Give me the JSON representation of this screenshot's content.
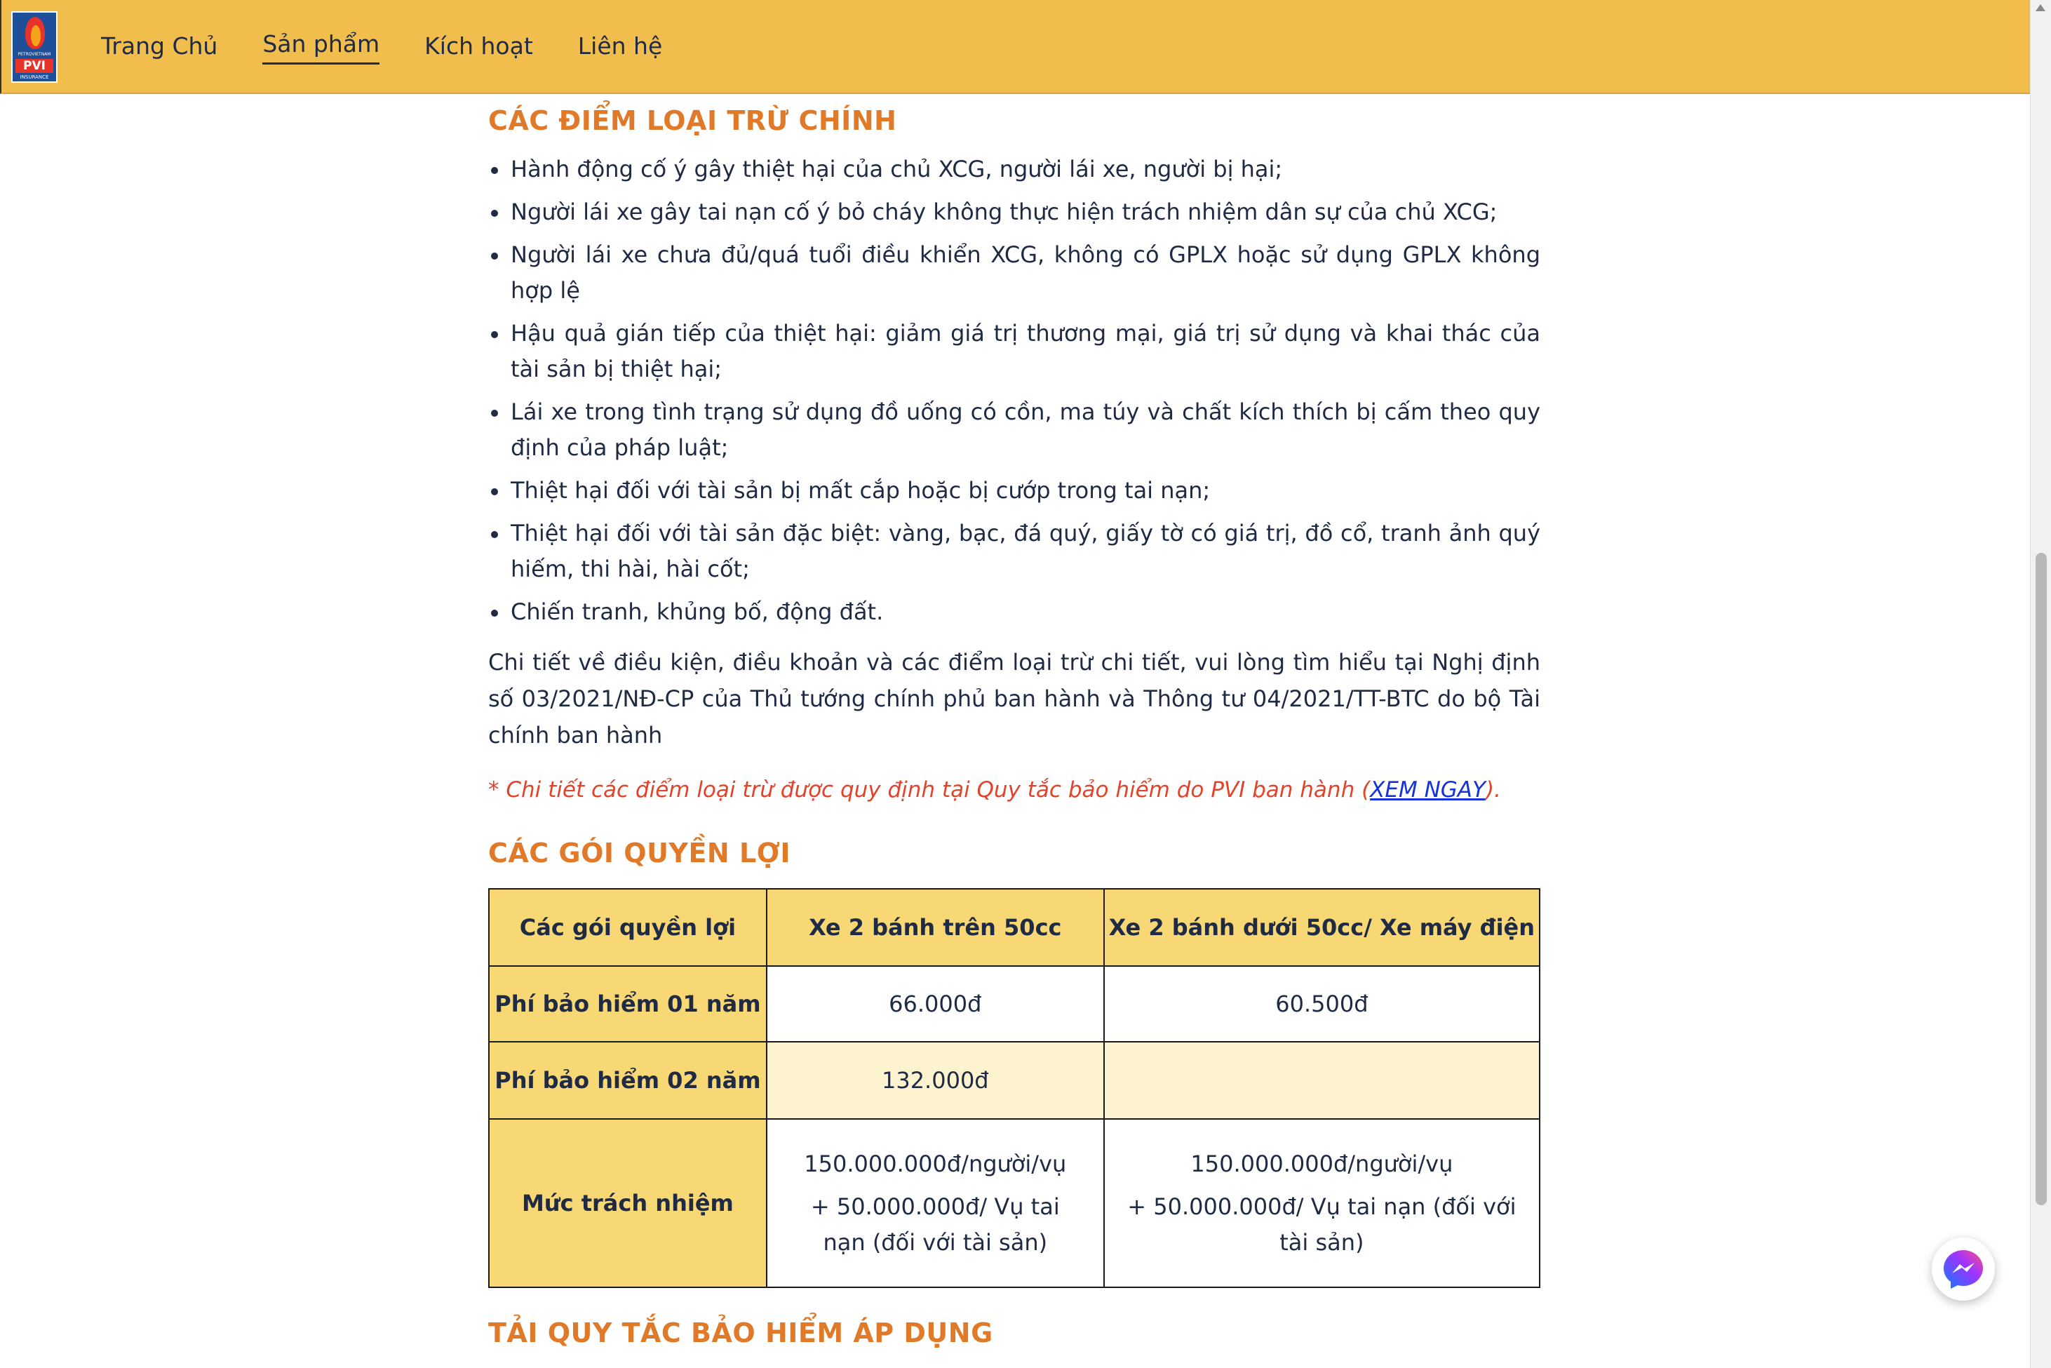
{
  "logo": {
    "brand": "PETROVIETNAM",
    "pvi": "PVI",
    "insurance": "INSURANCE"
  },
  "nav": {
    "items": [
      {
        "label": "Trang Chủ"
      },
      {
        "label": "Sản phẩm"
      },
      {
        "label": "Kích hoạt"
      },
      {
        "label": "Liên hệ"
      }
    ]
  },
  "exclusions": {
    "title": "CÁC ĐIỂM LOẠI TRỪ CHÍNH",
    "items": [
      "Hành động cố ý gây thiệt hại của chủ XCG, người lái xe, người bị hại;",
      "Người lái xe gây tai nạn cố ý bỏ cháy không thực hiện trách nhiệm dân sự của chủ XCG;",
      "Người lái xe chưa đủ/quá tuổi điều khiển XCG, không có GPLX hoặc sử dụng GPLX không hợp lệ",
      "Hậu quả gián tiếp của thiệt hại: giảm giá trị thương mại, giá trị sử dụng và khai thác của tài sản bị thiệt hại;",
      "Lái xe trong tình trạng sử dụng đồ uống có cồn, ma túy và chất kích thích bị cấm theo quy định của pháp luật;",
      "Thiệt hại đối với tài sản bị mất cắp hoặc bị cướp trong tai nạn;",
      "Thiệt hại đối với tài sản đặc biệt: vàng, bạc, đá quý, giấy tờ có giá trị, đồ cổ, tranh ảnh quý hiếm, thi hài, hài cốt;",
      "Chiến tranh, khủng bố, động đất."
    ],
    "detail": "Chi tiết về điều kiện, điều khoản và các điểm loại trừ chi tiết, vui lòng tìm hiểu tại Nghị định số 03/2021/NĐ-CP của Thủ tướng chính phủ ban hành và Thông tư 04/2021/TT-BTC do bộ Tài chính ban hành",
    "note_prefix": "* Chi tiết các điểm loại trừ được quy định tại Quy tắc bảo hiểm do PVI ban hành (",
    "note_link": "XEM NGAY",
    "note_suffix": ")."
  },
  "benefits": {
    "title": "CÁC GÓI QUYỀN LỢI",
    "headers": [
      "Các gói quyền lợi",
      "Xe 2 bánh trên 50cc",
      "Xe 2 bánh dưới 50cc/ Xe máy điện"
    ],
    "rows": [
      {
        "label": "Phí bảo hiểm 01 năm",
        "c1": "66.000đ",
        "c2": "60.500đ"
      },
      {
        "label": "Phí bảo hiểm 02 năm",
        "c1": "132.000đ",
        "c2": ""
      },
      {
        "label": "Mức trách nhiệm",
        "c1_line1": "150.000.000đ/người/vụ",
        "c1_line2": "+ 50.000.000đ/ Vụ tai nạn (đối với tài sản)",
        "c2_line1": "150.000.000đ/người/vụ",
        "c2_line2": "+ 50.000.000đ/ Vụ tai nạn (đối với tài sản)"
      }
    ]
  },
  "download": {
    "title": "TẢI QUY TẮC BẢO HIỂM ÁP DỤNG"
  },
  "colors": {
    "header_bg": "#f1bd4d",
    "section_title": "#e07a28",
    "table_head": "#f8d775",
    "note_red": "#e2442b",
    "link_blue": "#1533d8"
  },
  "icons": {
    "messenger": "messenger-icon",
    "logo": "pvi-logo"
  }
}
